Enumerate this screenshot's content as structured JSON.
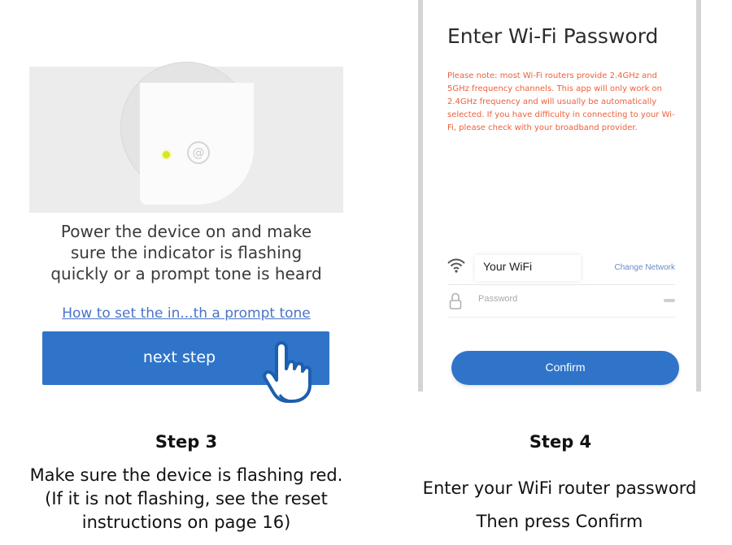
{
  "step3": {
    "instruction": "Power the device on and make sure the indicator is flashing quickly or a prompt tone is heard",
    "help_link": "How to set the in...th a  prompt tone",
    "next_button": "next step",
    "title": "Step 3",
    "description": "Make sure the device is flashing red. (If it is not flashing, see the reset instructions on page 16)"
  },
  "step4": {
    "screen_title": "Enter Wi-Fi Password",
    "note": "Please note: most Wi-Fi routers provide 2.4GHz and 5GHz frequency channels. This app will only work on 2.4GHz frequency and will usually be automatically selected. If you have difficulty in connecting to your Wi-Fi, please check with your broadband provider.",
    "ssid": "Your WiFi",
    "change_network": "Change Network",
    "password_placeholder": "Password",
    "confirm_button": "Confirm",
    "title": "Step 4",
    "line1": "Enter your WiFi router password",
    "line2": "Then press Confirm"
  },
  "colors": {
    "primary_blue": "#2f74c9",
    "note_red": "#ee5f3a",
    "link_blue": "#4a73c9",
    "indicator": "#d7e81a"
  },
  "icons": [
    "at-icon",
    "pointing-hand-icon",
    "wifi-icon",
    "lock-icon",
    "eye-icon"
  ]
}
